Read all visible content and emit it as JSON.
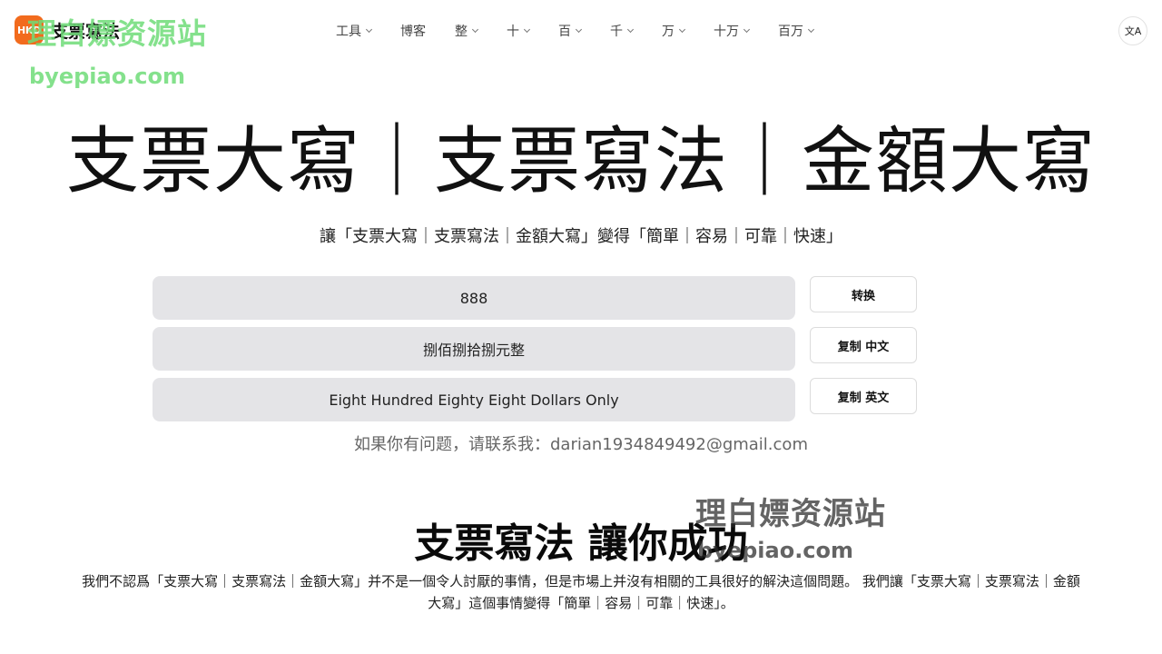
{
  "brand": {
    "logo_text": "HKD",
    "name": "支票寫法"
  },
  "nav": {
    "items": [
      {
        "label": "工具",
        "has_dropdown": true
      },
      {
        "label": "博客",
        "has_dropdown": false
      },
      {
        "label": "整",
        "has_dropdown": true
      },
      {
        "label": "十",
        "has_dropdown": true
      },
      {
        "label": "百",
        "has_dropdown": true
      },
      {
        "label": "千",
        "has_dropdown": true
      },
      {
        "label": "万",
        "has_dropdown": true
      },
      {
        "label": "十万",
        "has_dropdown": true
      },
      {
        "label": "百万",
        "has_dropdown": true
      }
    ],
    "language_icon": "translate-icon",
    "language_glyph": "文A"
  },
  "watermark": {
    "cn": "理白嫖资源站",
    "url": "byepiao.com"
  },
  "hero": {
    "title": "支票大寫｜支票寫法｜金額大寫",
    "subtitle": "讓「支票大寫｜支票寫法｜金額大寫」變得「簡單｜容易｜可靠｜快速」"
  },
  "converter": {
    "amount_input": "888",
    "chinese_output": "捌佰捌拾捌元整",
    "english_output": "Eight Hundred Eighty Eight Dollars Only",
    "convert_label": "转换",
    "copy_chinese_label": "复制 中文",
    "copy_english_label": "复制 英文"
  },
  "contact": "如果你有问题，请联系我：darian1934849492@gmail.com",
  "section": {
    "title": "支票寫法 讓你成功",
    "body": "我們不認爲「支票大寫｜支票寫法｜金額大寫」并不是一個令人討厭的事情，但是市場上并沒有相關的工具很好的解決這個問題。 我們讓「支票大寫｜支票寫法｜金額大寫」這個事情變得「簡單｜容易｜可靠｜快速」。"
  },
  "colors": {
    "brand_accent": "#f26b1d",
    "field_bg": "#e4e4e7",
    "watermark_green": "#6edc78"
  }
}
